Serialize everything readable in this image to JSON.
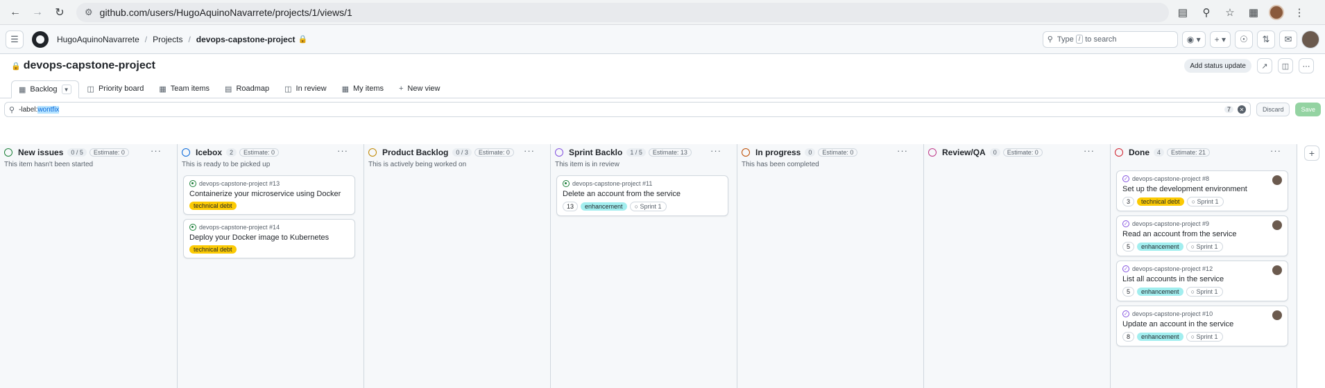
{
  "browser": {
    "url": "github.com/users/HugoAquinoNavarrete/projects/1/views/1"
  },
  "header": {
    "breadcrumb": [
      "HugoAquinoNavarrete",
      "Projects",
      "devops-capstone-project"
    ],
    "search_placeholder_a": "Type",
    "search_key": "/",
    "search_placeholder_b": "to search"
  },
  "project": {
    "title": "devops-capstone-project",
    "status_update_label": "Add status update"
  },
  "tabs": [
    {
      "label": "Backlog",
      "icon": "table-icon"
    },
    {
      "label": "Priority board",
      "icon": "board-icon"
    },
    {
      "label": "Team items",
      "icon": "table-icon"
    },
    {
      "label": "Roadmap",
      "icon": "roadmap-icon"
    },
    {
      "label": "In review",
      "icon": "board-icon"
    },
    {
      "label": "My items",
      "icon": "table-icon"
    },
    {
      "label": "New view",
      "icon": "plus-icon"
    }
  ],
  "filter": {
    "prefix": "-label:",
    "value": "wontfix",
    "count": "7",
    "discard_label": "Discard",
    "save_label": "Save"
  },
  "columns": [
    {
      "name": "New issues",
      "count": "0 / 5",
      "estimate": "Estimate: 0",
      "desc": "This item hasn't been started",
      "color": "#1a7f37",
      "cards": []
    },
    {
      "name": "Icebox",
      "count": "2",
      "estimate": "Estimate: 0",
      "desc": "This is ready to be picked up",
      "color": "#0969da",
      "cards": [
        {
          "ref": "devops-capstone-project #13",
          "title": "Containerize your microservice using Docker",
          "num": "",
          "tag": "technical debt",
          "tag_type": "td",
          "sprint": "",
          "state": "open"
        },
        {
          "ref": "devops-capstone-project #14",
          "title": "Deploy your Docker image to Kubernetes",
          "num": "",
          "tag": "technical debt",
          "tag_type": "td",
          "sprint": "",
          "state": "open"
        }
      ]
    },
    {
      "name": "Product Backlog",
      "count": "0 / 3",
      "estimate": "Estimate: 0",
      "desc": "This is actively being worked on",
      "color": "#bf8700",
      "cards": []
    },
    {
      "name": "Sprint Backlo",
      "count": "1 / 5",
      "estimate": "Estimate: 13",
      "desc": "This item is in review",
      "color": "#8250df",
      "cards": [
        {
          "ref": "devops-capstone-project #11",
          "title": "Delete an account from the service",
          "num": "13",
          "tag": "enhancement",
          "tag_type": "en",
          "sprint": "Sprint 1",
          "state": "open"
        }
      ]
    },
    {
      "name": "In progress",
      "count": "0",
      "estimate": "Estimate: 0",
      "desc": "This has been completed",
      "color": "#bc4c00",
      "cards": []
    },
    {
      "name": "Review/QA",
      "count": "0",
      "estimate": "Estimate: 0",
      "desc": "",
      "color": "#bf3989",
      "cards": []
    },
    {
      "name": "Done",
      "count": "4",
      "estimate": "Estimate: 21",
      "desc": "",
      "color": "#cf222e",
      "cards": [
        {
          "ref": "devops-capstone-project #8",
          "title": "Set up the development environment",
          "num": "3",
          "tag": "technical debt",
          "tag_type": "td",
          "sprint": "Sprint 1",
          "state": "done"
        },
        {
          "ref": "devops-capstone-project #9",
          "title": "Read an account from the service",
          "num": "5",
          "tag": "enhancement",
          "tag_type": "en",
          "sprint": "Sprint 1",
          "state": "done"
        },
        {
          "ref": "devops-capstone-project #12",
          "title": "List all accounts in the service",
          "num": "5",
          "tag": "enhancement",
          "tag_type": "en",
          "sprint": "Sprint 1",
          "state": "done"
        },
        {
          "ref": "devops-capstone-project #10",
          "title": "Update an account in the service",
          "num": "8",
          "tag": "enhancement",
          "tag_type": "en",
          "sprint": "Sprint 1",
          "state": "done"
        }
      ]
    }
  ]
}
